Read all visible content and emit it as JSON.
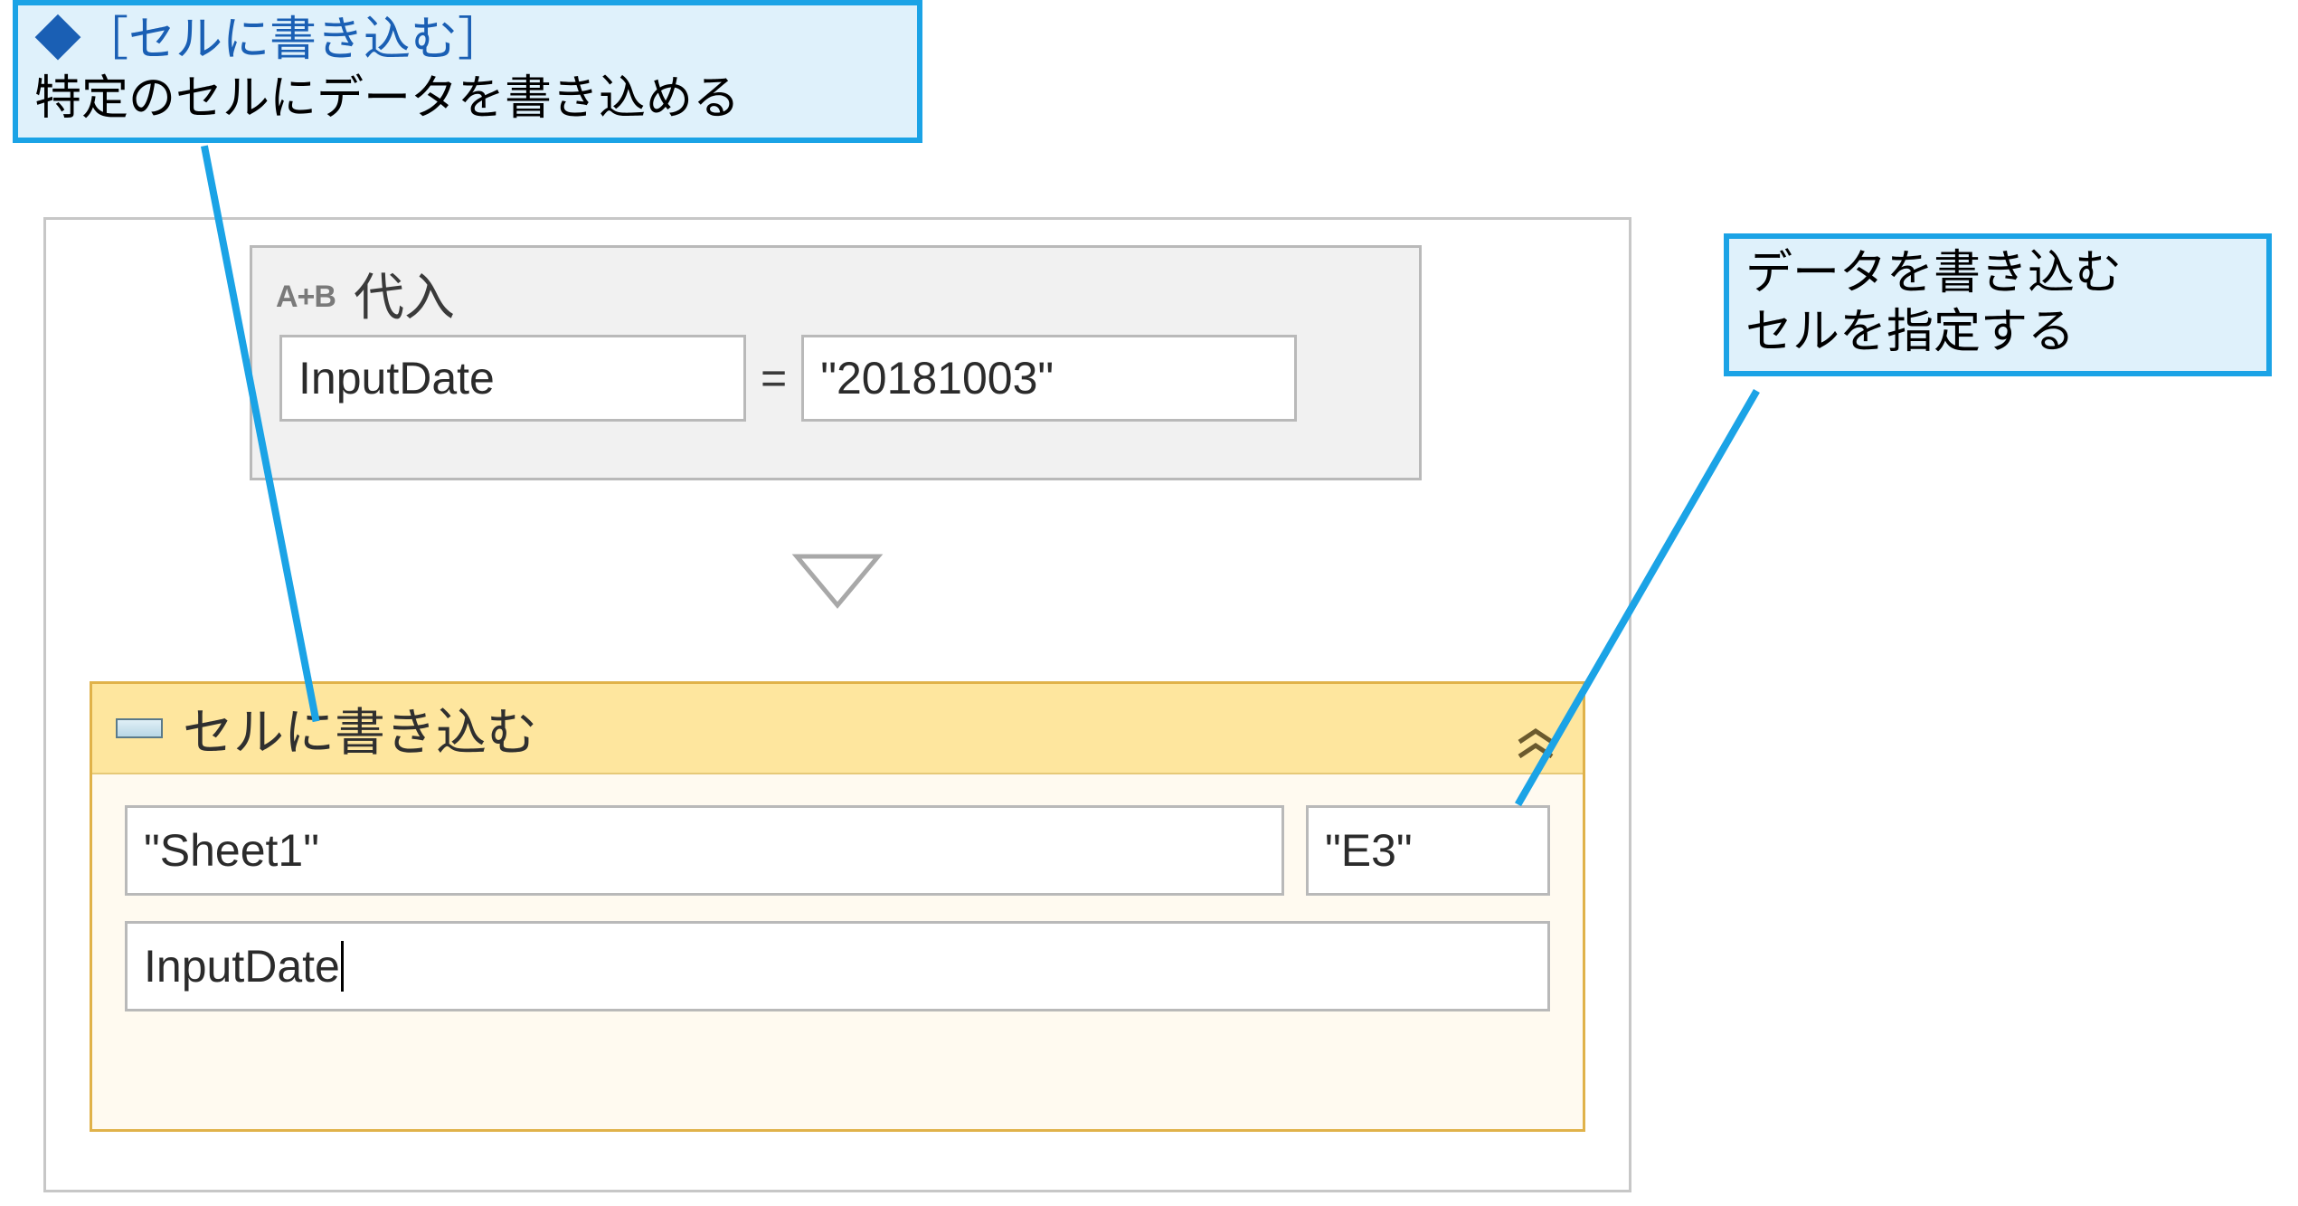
{
  "callouts": {
    "top": {
      "title_prefix": "◆",
      "title_text": "［セルに書き込む］",
      "body": "特定のセルにデータを書き込める"
    },
    "right": {
      "line1": "データを書き込む",
      "line2": "セルを指定する"
    }
  },
  "assign": {
    "icon_label": "A+B",
    "title": "代入",
    "left_field": "InputDate",
    "equals": "=",
    "right_field": "\"20181003\""
  },
  "write_cell": {
    "title": "セルに書き込む",
    "sheet_field": "\"Sheet1\"",
    "cell_field": "\"E3\"",
    "value_field": "InputDate"
  }
}
